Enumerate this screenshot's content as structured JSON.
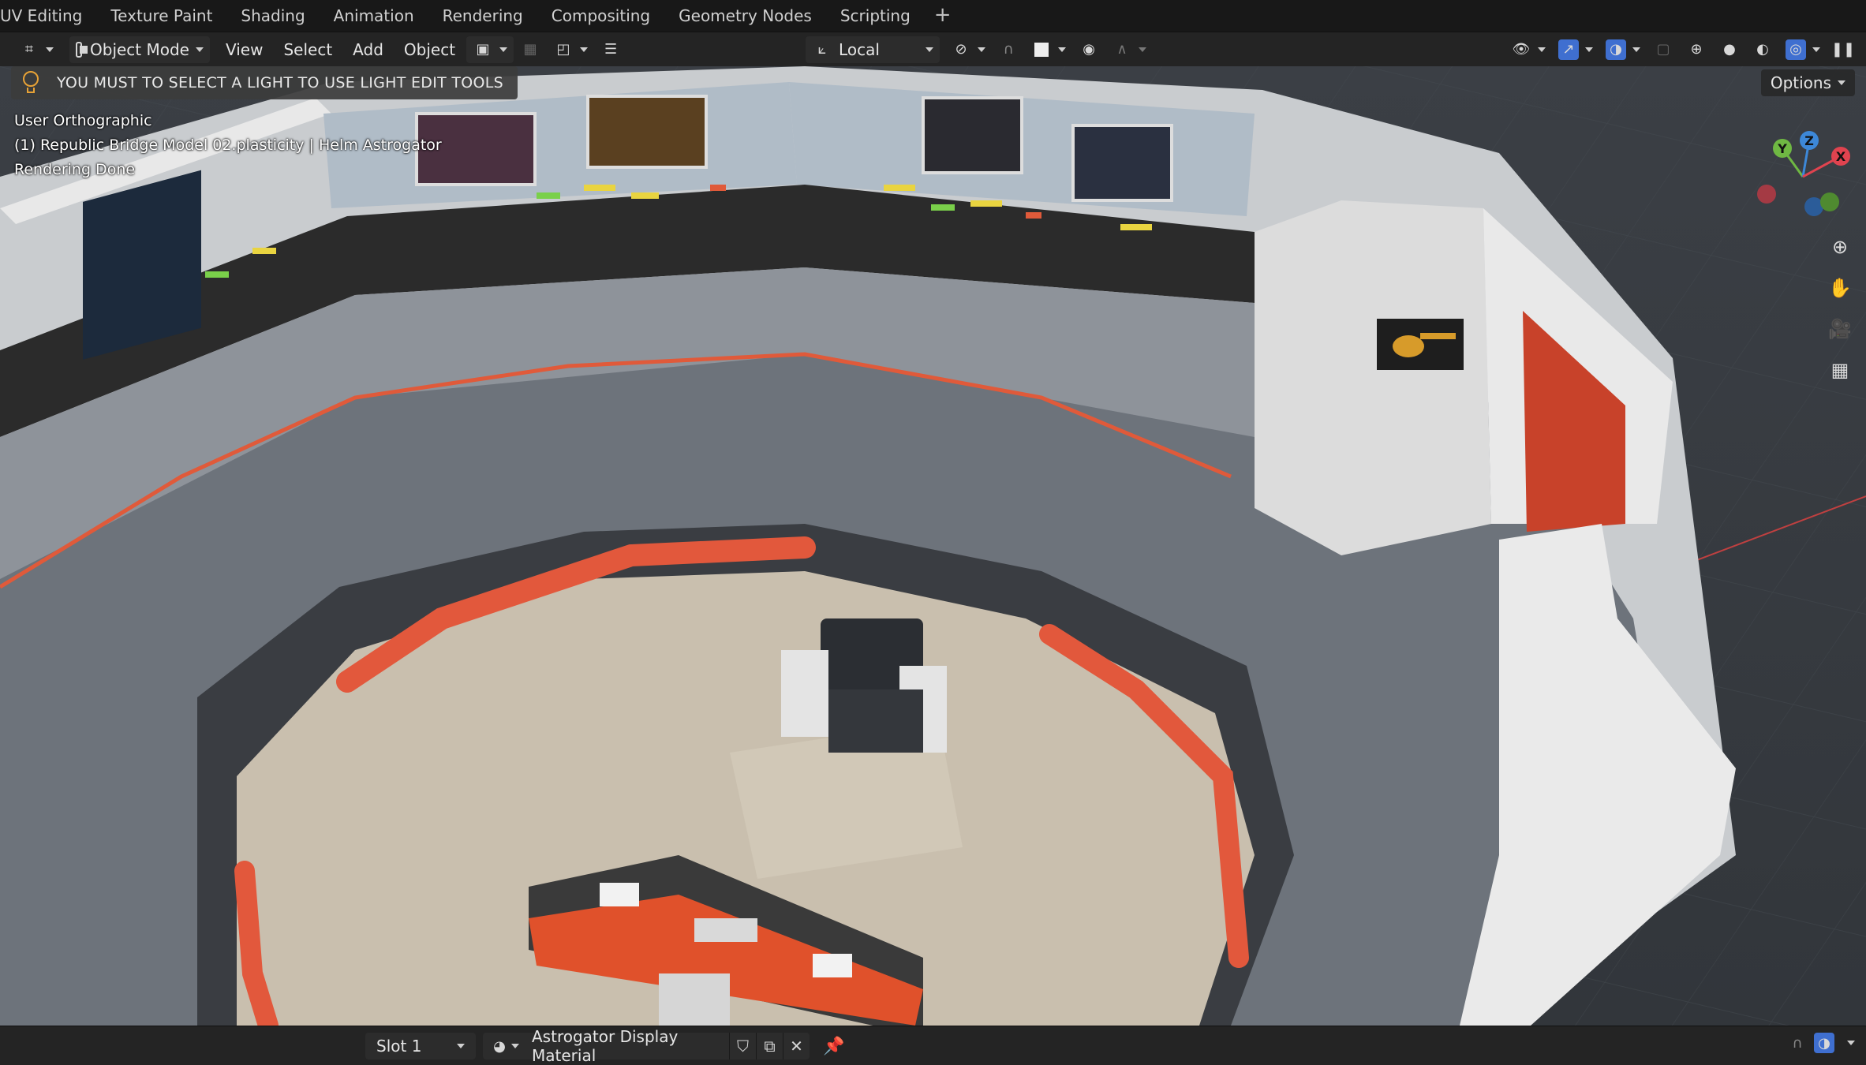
{
  "workspaces": [
    "UV Editing",
    "Texture Paint",
    "Shading",
    "Animation",
    "Rendering",
    "Compositing",
    "Geometry Nodes",
    "Scripting"
  ],
  "header": {
    "mode_label": "Object Mode",
    "menus": [
      "View",
      "Select",
      "Add",
      "Object"
    ],
    "transform_orientation": "Local"
  },
  "viewport": {
    "notice": "YOU MUST TO SELECT A LIGHT TO USE LIGHT EDIT TOOLS",
    "view_name": "User Orthographic",
    "object_info": "(1) Republic Bridge Model 02.plasticity | Helm Astrogator",
    "status": "Rendering Done",
    "options_label": "Options",
    "gizmo_axes": [
      "Y",
      "Z",
      "X"
    ],
    "colors": {
      "x_axis": "#e0434f",
      "y_axis": "#6fb843",
      "z_axis": "#3d88d8",
      "accent_red": "#e05a3a"
    }
  },
  "bottom": {
    "slot": "Slot 1",
    "material_name": "Astrogator Display Material"
  }
}
